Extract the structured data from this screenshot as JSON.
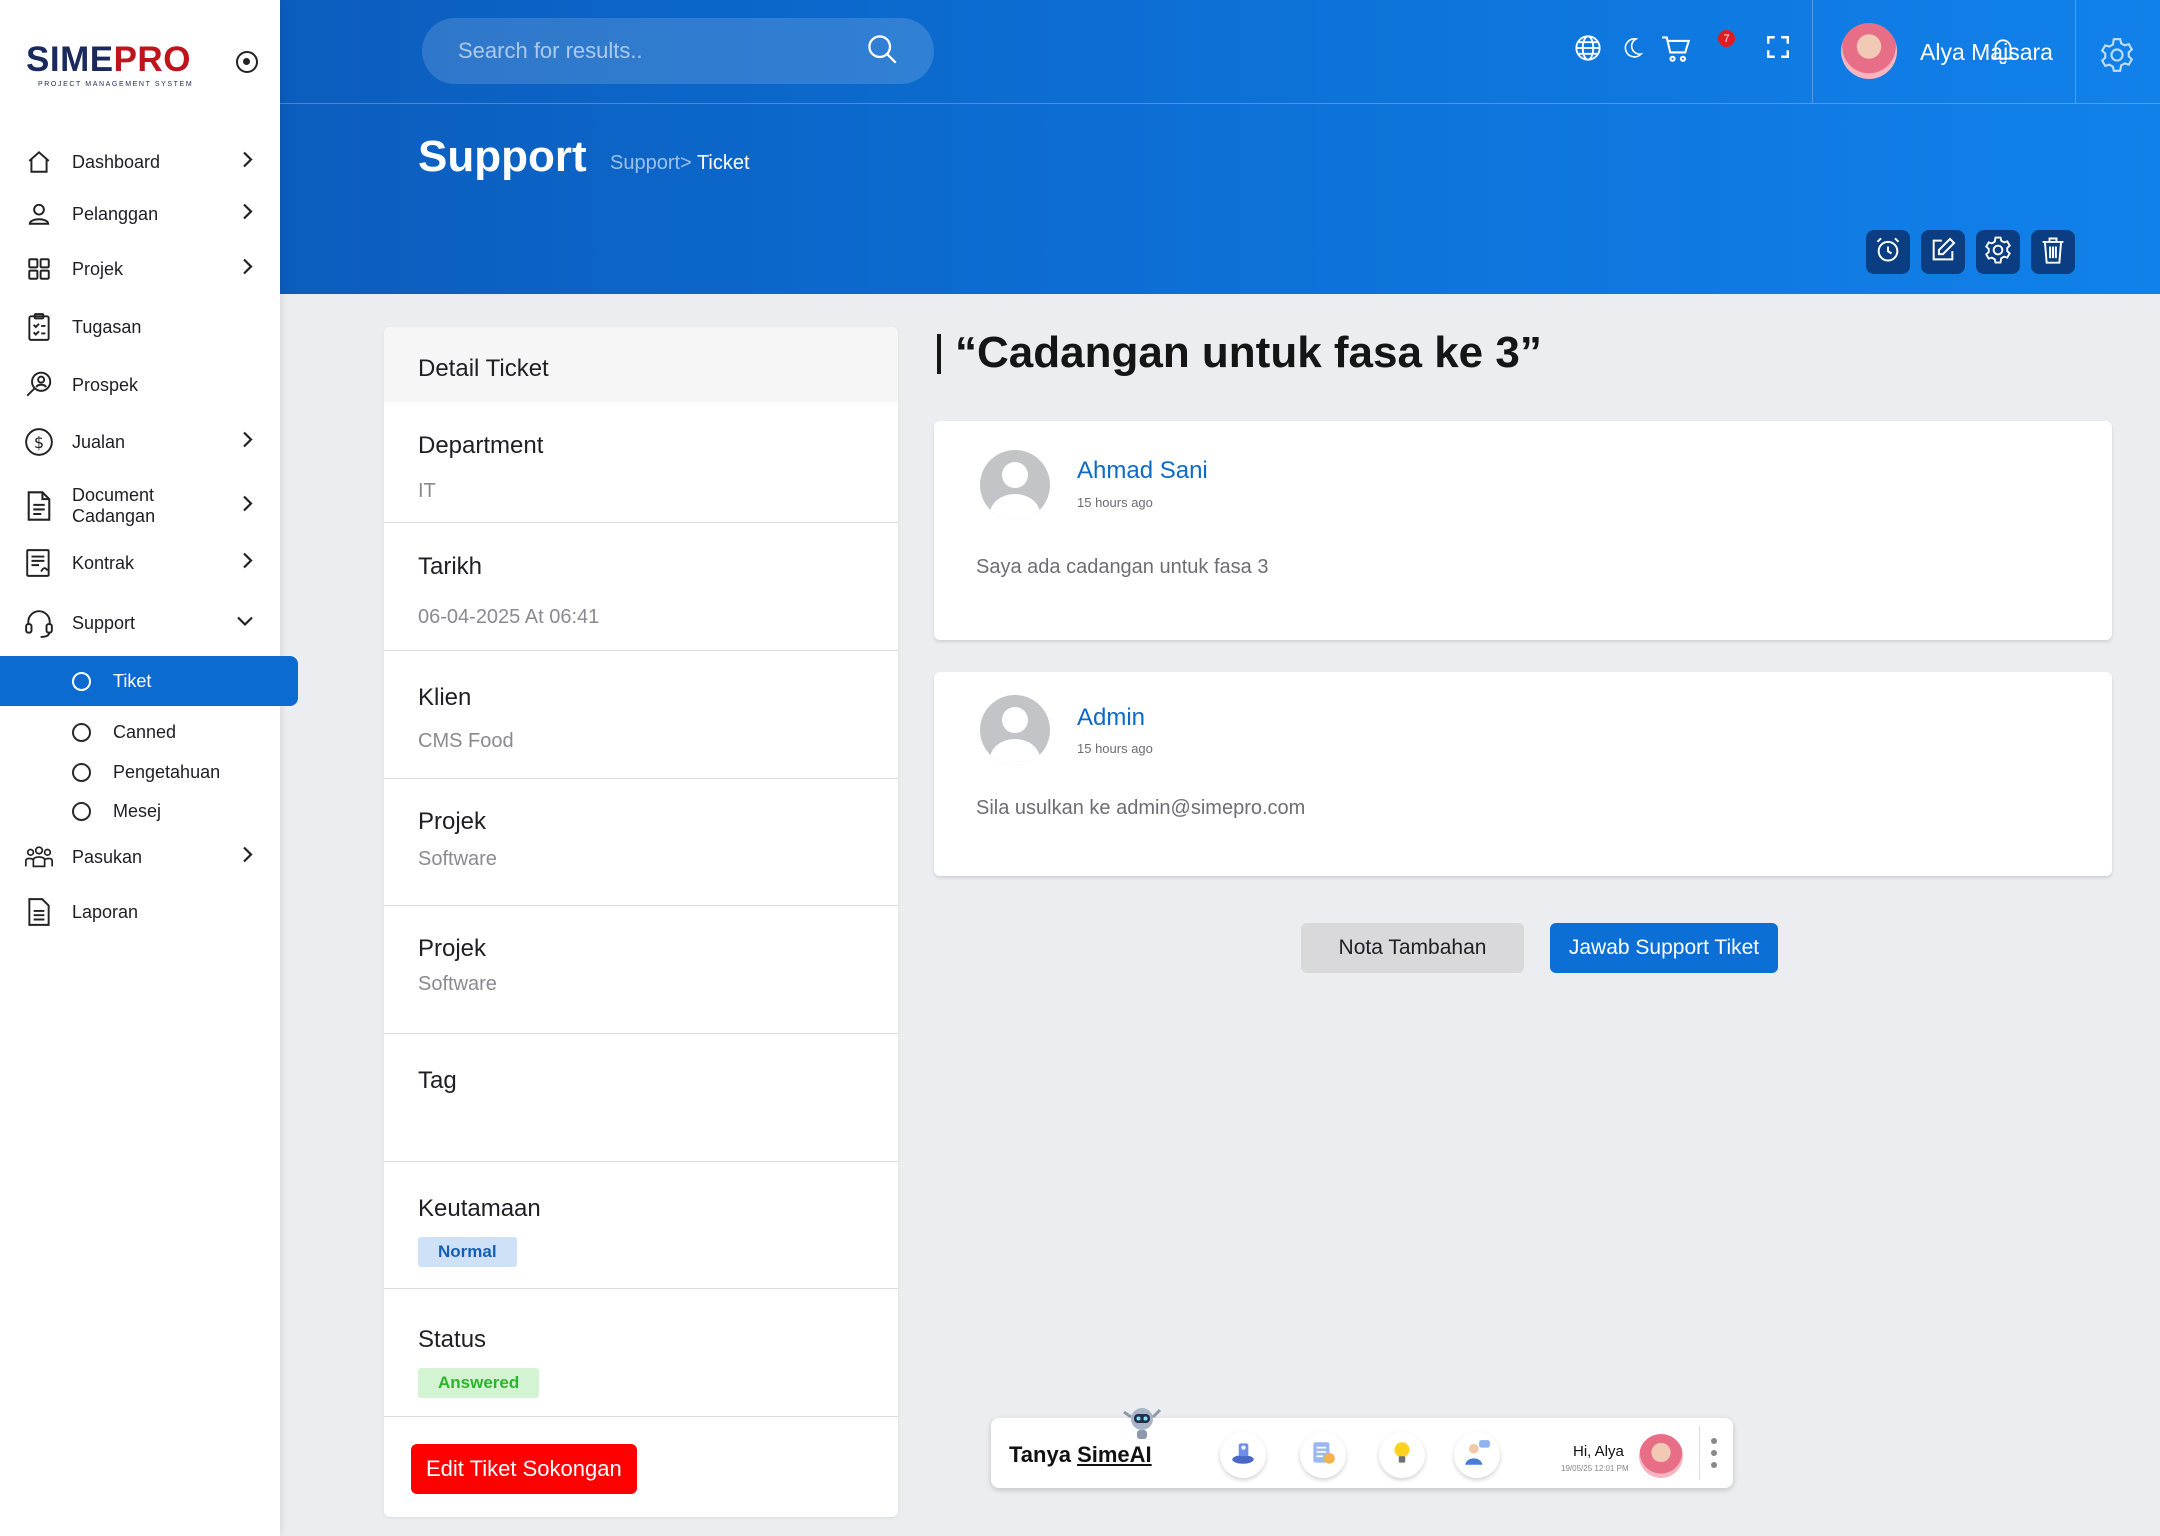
{
  "app": {
    "logo_sime": "SIME",
    "logo_pro": "PRO",
    "logo_tagline": "PROJECT MANAGEMENT SYSTEM"
  },
  "sidebar": {
    "items": [
      {
        "label": "Dashboard",
        "icon": "home-icon"
      },
      {
        "label": "Pelanggan",
        "icon": "user-icon"
      },
      {
        "label": "Projek",
        "icon": "grid-icon"
      },
      {
        "label": "Tugasan",
        "icon": "clipboard-icon"
      },
      {
        "label": "Prospek",
        "icon": "search-user-icon"
      },
      {
        "label": "Jualan",
        "icon": "dollar-icon"
      },
      {
        "label": "Document\nCadangan",
        "icon": "document-icon"
      },
      {
        "label": "Kontrak",
        "icon": "contract-icon"
      },
      {
        "label": "Support",
        "icon": "headset-icon"
      },
      {
        "label": "Pasukan",
        "icon": "team-icon"
      },
      {
        "label": "Laporan",
        "icon": "report-icon"
      }
    ],
    "support_sub": [
      "Tiket",
      "Canned",
      "Pengetahuan",
      "Mesej"
    ]
  },
  "header": {
    "search_placeholder": "Search for results..",
    "notification_count": "7",
    "user_name": "Alya Maisara",
    "page_title": "Support",
    "breadcrumb_parent": "Support>",
    "breadcrumb_current": "Ticket"
  },
  "detail": {
    "heading": "Detail Ticket",
    "fields": [
      {
        "key": "Department",
        "value": "IT"
      },
      {
        "key": "Tarikh",
        "value": "06-04-2025 At 06:41"
      },
      {
        "key": "Klien",
        "value": "CMS Food"
      },
      {
        "key": "Projek",
        "value": "Software"
      },
      {
        "key": "Projek",
        "value": "Software"
      },
      {
        "key": "Tag",
        "value": ""
      },
      {
        "key": "Keutamaan",
        "value": "Normal"
      },
      {
        "key": "Status",
        "value": "Answered"
      }
    ],
    "edit_button": "Edit Tiket Sokongan"
  },
  "thread": {
    "title": "“Cadangan untuk fasa ke 3”",
    "messages": [
      {
        "author": "Ahmad Sani",
        "time": "15 hours ago",
        "body": "Saya ada cadangan untuk fasa 3"
      },
      {
        "author": "Admin",
        "time": "15 hours ago",
        "body": "Sila usulkan ke admin@simepro.com"
      }
    ],
    "note_button": "Nota Tambahan",
    "reply_button": "Jawab Support Tiket"
  },
  "ai_bar": {
    "label_prefix": "Tanya ",
    "label_brand": "SimeAI",
    "greeting": "Hi, Alya",
    "date": "19/05/25 12:01 PM"
  },
  "colors": {
    "primary": "#0b6bd1",
    "brand_navy": "#1b2a5c",
    "brand_red": "#c0141d",
    "danger": "#ff0000"
  }
}
